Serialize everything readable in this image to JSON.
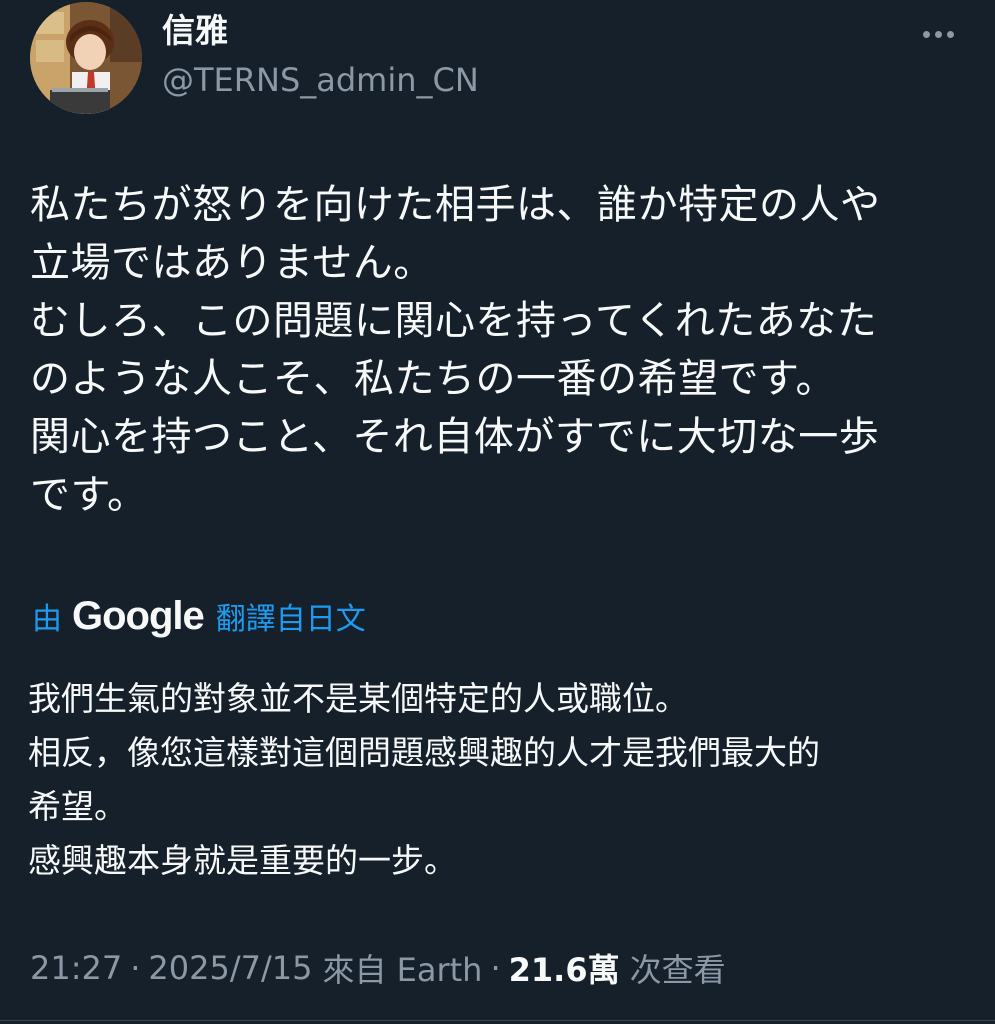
{
  "author": {
    "display_name": "信雅",
    "handle": "@TERNS_admin_CN"
  },
  "tweet": {
    "text": "私たちが怒りを向けた相手は、誰か特定の人や\n立場ではありません。\nむしろ、この問題に関心を持ってくれたあなた\nのような人こそ、私たちの一番の希望です。\n関心を持つこと、それ自体がすでに大切な一歩\nです。"
  },
  "translation": {
    "prefix": "由",
    "provider": "Google",
    "suffix": "翻譯自日文",
    "text": "我們生氣的對象並不是某個特定的人或職位。\n相反，像您這樣對這個問題感興趣的人才是我們最大的\n希望。\n感興趣本身就是重要的一步。"
  },
  "meta": {
    "time": "21:27",
    "separator": "·",
    "date": "2025/7/15",
    "location": "來自 Earth",
    "views_count": "21.6萬",
    "views_label": "次查看"
  },
  "icons": {
    "more": "more-horizontal-icon"
  },
  "colors": {
    "background": "#15202b",
    "text_primary": "#f7f9f9",
    "text_secondary": "#8b98a5",
    "link": "#1d9bf0"
  }
}
